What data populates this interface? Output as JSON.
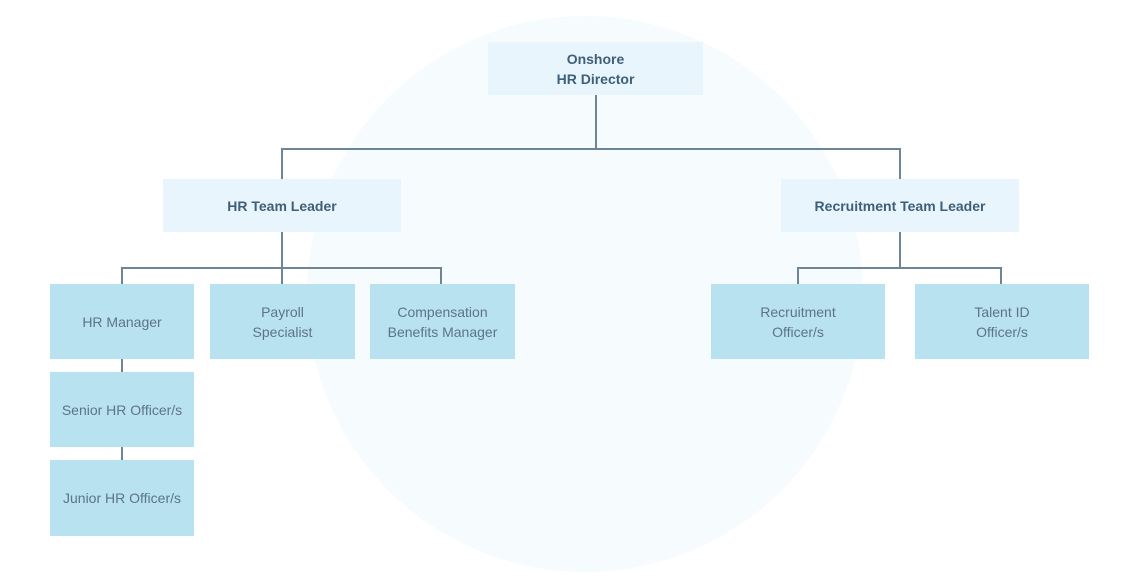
{
  "colors": {
    "background": "#ffffff",
    "circle": "#f6fbfe",
    "leader_box": "#e9f5fc",
    "role_box": "#b8e2f0",
    "connector": "#6e8597",
    "leader_text": "#3e5f78",
    "role_text": "#5d7486"
  },
  "org": {
    "director": {
      "label": "Onshore\nHR Director"
    },
    "hr_team_leader": {
      "label": "HR Team Leader"
    },
    "recruitment_team_leader": {
      "label": "Recruitment Team Leader"
    },
    "hr_roles": [
      {
        "label": "HR Manager"
      },
      {
        "label": "Payroll\nSpecialist"
      },
      {
        "label": "Compensation\nBenefits Manager"
      }
    ],
    "hr_manager_reports": [
      {
        "label": "Senior HR Officer/s"
      },
      {
        "label": "Junior HR Officer/s"
      }
    ],
    "recruitment_roles": [
      {
        "label": "Recruitment\nOfficer/s"
      },
      {
        "label": "Talent ID\nOfficer/s"
      }
    ]
  }
}
